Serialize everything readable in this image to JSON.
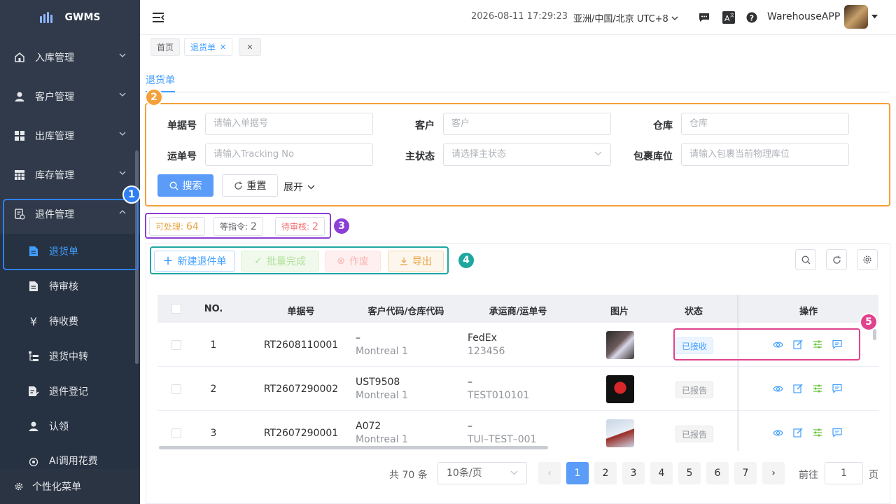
{
  "app": {
    "name": "GWMS"
  },
  "sidebar": {
    "menus": [
      {
        "label": "入库管理",
        "icon": "home-icon"
      },
      {
        "label": "客户管理",
        "icon": "user-icon"
      },
      {
        "label": "出库管理",
        "icon": "grid-icon"
      },
      {
        "label": "库存管理",
        "icon": "table-icon"
      },
      {
        "label": "退件管理",
        "icon": "return-doc-icon"
      }
    ],
    "submenus": [
      {
        "label": "退货单",
        "icon": "document-icon"
      },
      {
        "label": "待审核",
        "icon": "document-icon"
      },
      {
        "label": "待收费",
        "icon": "yen-icon"
      },
      {
        "label": "退货中转",
        "icon": "list-tree-icon"
      },
      {
        "label": "退件登记",
        "icon": "edit-doc-icon"
      },
      {
        "label": "认领",
        "icon": "user-icon"
      },
      {
        "label": "AI调用花费",
        "icon": "coin-icon"
      }
    ],
    "bottom": "个性化菜单"
  },
  "header": {
    "time": "2026-08-11 17:29:23",
    "timezone": "亚洲/中国/北京 UTC+8",
    "user": "WarehouseAPP"
  },
  "tags": {
    "home": "首页",
    "current": "退货单"
  },
  "page": {
    "tab": "退货单"
  },
  "filter": {
    "doc_no_label": "单据号",
    "doc_no_placeholder": "请输入单据号",
    "customer_label": "客户",
    "customer_placeholder": "客户",
    "warehouse_label": "仓库",
    "warehouse_placeholder": "仓库",
    "tracking_label": "运单号",
    "tracking_placeholder": "请输入Tracking No",
    "status_label": "主状态",
    "status_placeholder": "请选择主状态",
    "location_label": "包裹库位",
    "location_placeholder": "请输入包裹当前物理库位",
    "search": "搜索",
    "reset": "重置",
    "expand": "展开"
  },
  "counters": [
    {
      "label": "可处理:",
      "value": "64",
      "color": "#e6a23c"
    },
    {
      "label": "等指令:",
      "value": "2",
      "color": "#606266"
    },
    {
      "label": "待审核:",
      "value": "2",
      "color": "#f56c6c"
    }
  ],
  "actions": {
    "new": "新建退件单",
    "batch": "批量完成",
    "void": "作废",
    "export": "导出"
  },
  "table": {
    "headers": [
      "NO.",
      "单据号",
      "客户代码/仓库代码",
      "承运商/运单号",
      "图片",
      "状态",
      "操作"
    ],
    "rows": [
      {
        "no": "1",
        "doc": "RT2608110001",
        "cust": "–",
        "wh": "Montreal 1",
        "carrier": "FedEx",
        "tracking": "123456",
        "status": "已接收"
      },
      {
        "no": "2",
        "doc": "RT2607290002",
        "cust": "UST9508",
        "wh": "Montreal 1",
        "carrier": "–",
        "tracking": "TEST010101",
        "status": "已报告"
      },
      {
        "no": "3",
        "doc": "RT2607290001",
        "cust": "A072",
        "wh": "Montreal 1",
        "carrier": "–",
        "tracking": "TUI–TEST–001",
        "status": "已报告"
      }
    ]
  },
  "pagination": {
    "total": "共 70 条",
    "size": "10条/页",
    "pages": [
      "1",
      "2",
      "3",
      "4",
      "5",
      "6",
      "7"
    ],
    "goto": "前往",
    "goto_value": "1",
    "page_suffix": "页"
  },
  "markers": [
    "1",
    "2",
    "3",
    "4",
    "5"
  ],
  "colors": {
    "primary": "#409eff",
    "sidebar": "#303a4a",
    "orange": "#f5a03a",
    "purple": "#8c3fd6",
    "teal": "#1ea7a0",
    "pink": "#e0438e",
    "blue_outline": "#2f7ff5"
  }
}
